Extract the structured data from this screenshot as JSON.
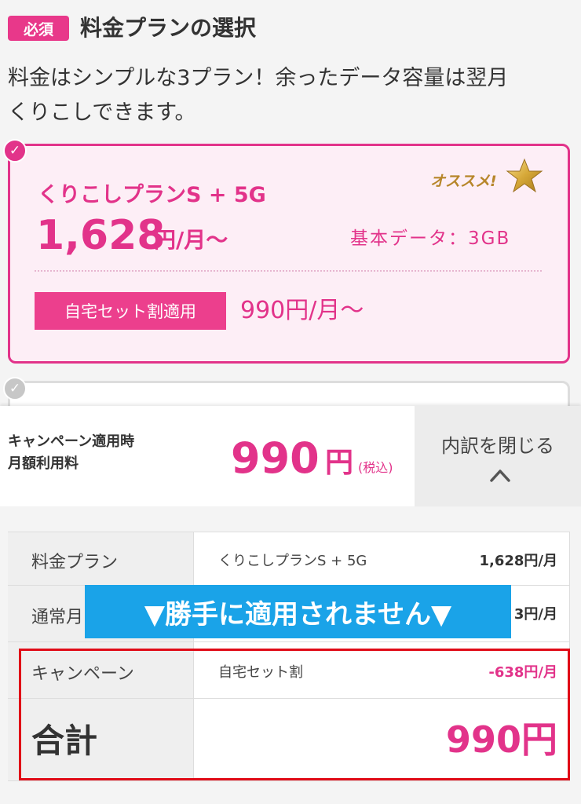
{
  "header": {
    "required_badge": "必須",
    "title": "料金プランの選択",
    "lead_line1": "料金はシンプルな3プラン！余ったデータ容量は翌月",
    "lead_line2": "くりこしできます。"
  },
  "plan_card": {
    "selected": true,
    "name": "くりこしプランS + 5G",
    "recommend_label": "オススメ!",
    "recommend_icon": "star-icon",
    "price": "1,628",
    "price_unit": "円/月〜",
    "base_data": "基本データ：3GB",
    "discount_badge": "自宅セット割適用",
    "discount_price": "990円/月〜"
  },
  "summary": {
    "label_line1": "キャンペーン適用時",
    "label_line2": "月額利用料",
    "price": "990",
    "yen": "円",
    "tax": "(税込)",
    "close_label": "内訳を閉じる",
    "close_icon": "chevron-up-icon"
  },
  "breakdown": {
    "plan_row": {
      "label": "料金プラン",
      "desc": "くりこしプランS + 5G",
      "amount": "1,628円/月"
    },
    "normal_row": {
      "label": "通常月",
      "amount": "3円/月"
    },
    "campaign_row": {
      "label": "キャンペーン",
      "desc": "自宅セット割",
      "amount": "-638円/月"
    },
    "total_row": {
      "label": "合計",
      "amount": "990円"
    }
  },
  "overlay": {
    "banner": "▼勝手に適用されません▼"
  },
  "colors": {
    "brand_pink": "#e2338a",
    "banner_blue": "#1aa3e8",
    "highlight_red": "#e00b17"
  }
}
